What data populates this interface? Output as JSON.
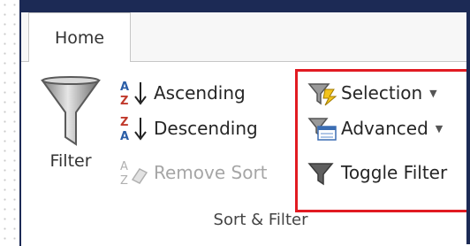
{
  "tabs": {
    "home": "Home"
  },
  "sort_filter": {
    "filter_label": "Filter",
    "ascending_label": "Ascending",
    "descending_label": "Descending",
    "remove_sort_label": "Remove Sort",
    "selection_label": "Selection",
    "advanced_label": "Advanced",
    "toggle_filter_label": "Toggle Filter",
    "group_label": "Sort & Filter",
    "dropdown_glyph": "▼"
  },
  "icons": {
    "filter": "funnel-icon",
    "ascending": "sort-ascending-icon",
    "descending": "sort-descending-icon",
    "remove_sort": "remove-sort-icon",
    "selection": "selection-filter-icon",
    "advanced": "advanced-filter-icon",
    "toggle_filter": "toggle-filter-icon"
  },
  "colors": {
    "frame": "#1c2a55",
    "highlight": "#e11b22",
    "disabled_text": "#a6a6a6"
  }
}
